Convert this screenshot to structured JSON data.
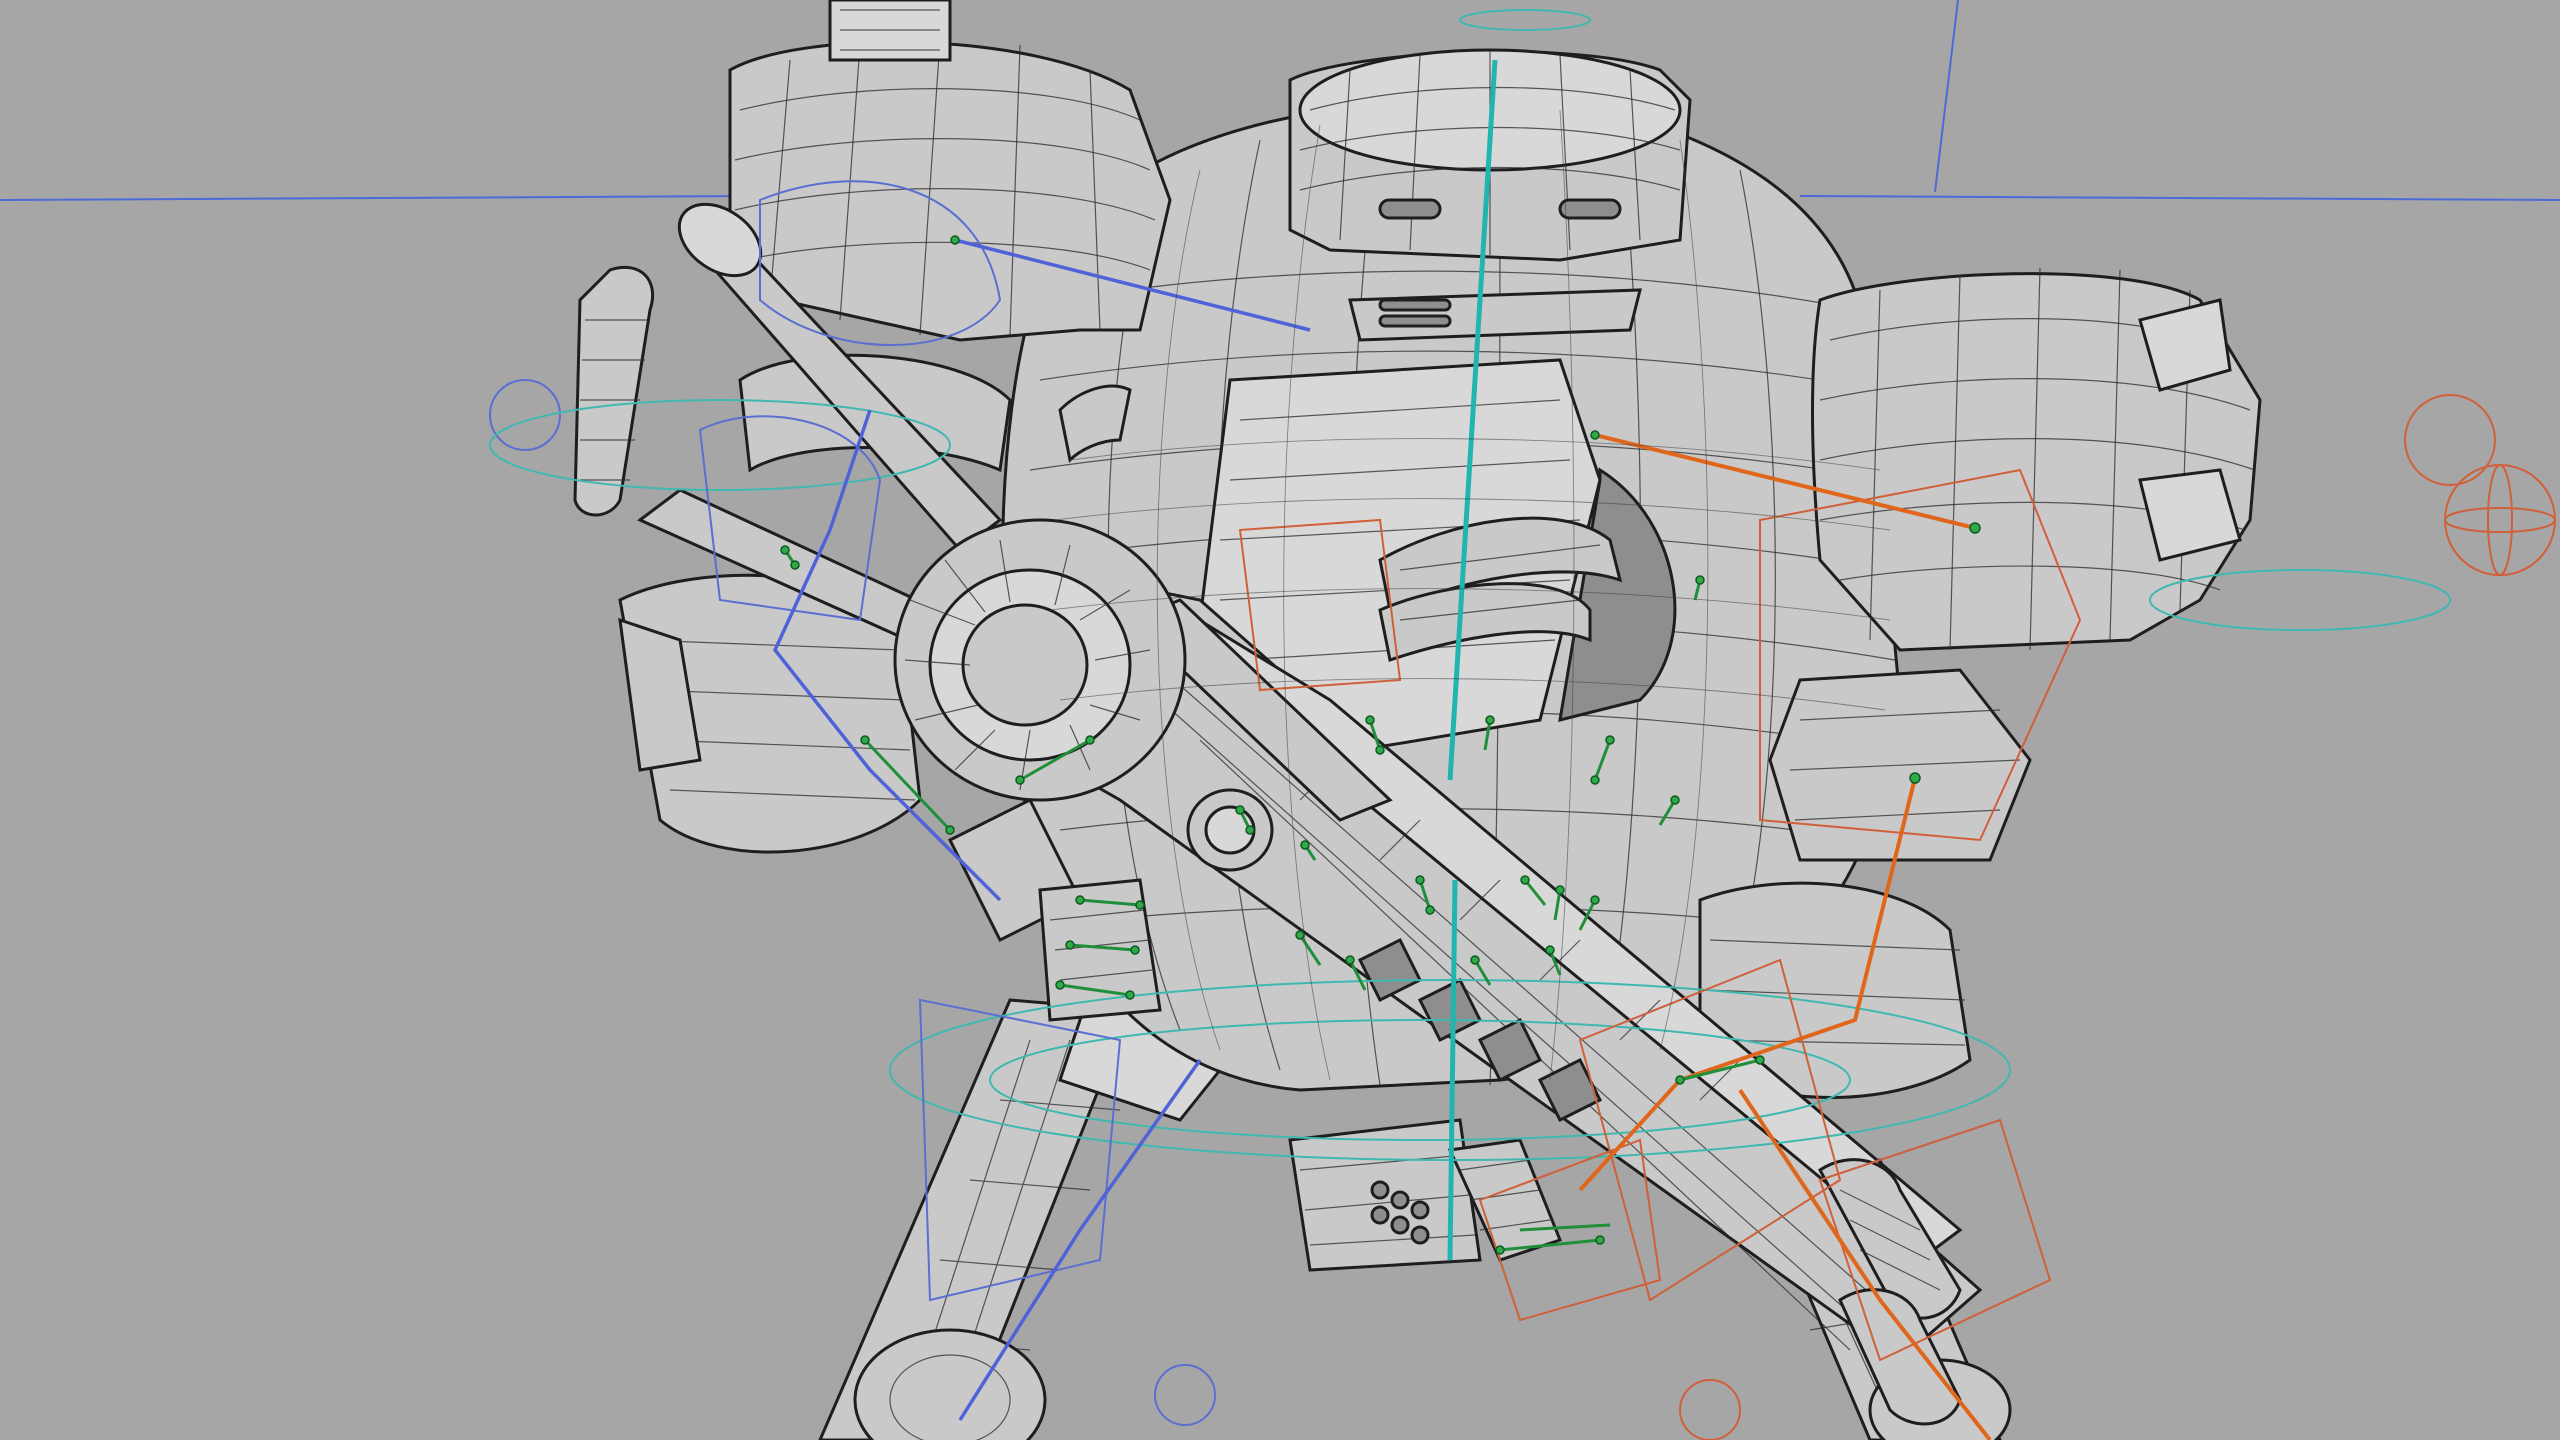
{
  "viewport": {
    "background": "#a6a6a6",
    "display_mode": "wireframe-on-shaded",
    "rig_colors": {
      "left_side": "#5062d8",
      "right_side": "#e0661c",
      "spine": "#1fb6b0",
      "controls": "#2fa94a"
    }
  },
  "model": {
    "subject": "mech-robot-with-rifle",
    "parts": [
      "head-cap",
      "torso-sphere",
      "left-shoulder-pad",
      "right-shoulder-pad",
      "rifle",
      "left-leg",
      "right-leg",
      "hip-armor"
    ]
  },
  "icons": {
    "camera": "viewport-camera",
    "joint": "joint-icon"
  }
}
